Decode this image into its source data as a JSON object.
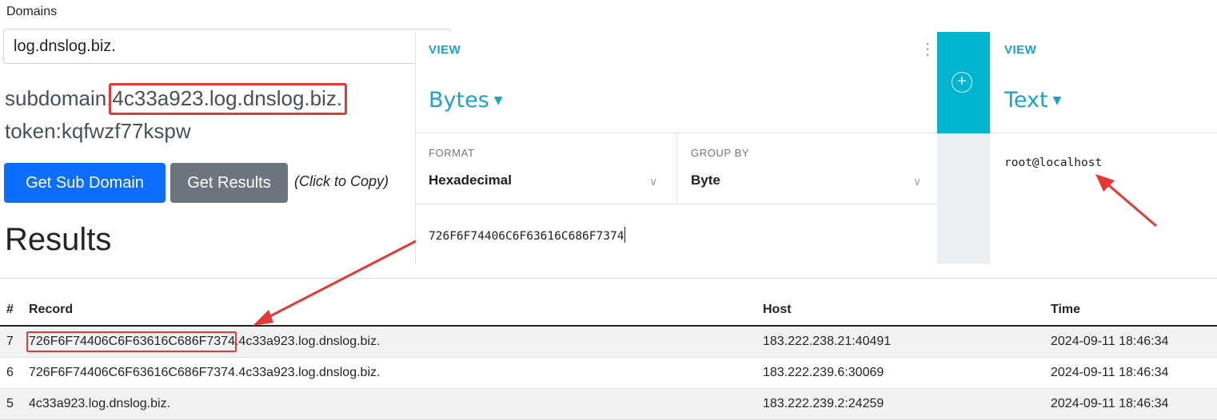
{
  "dnslog": {
    "domains_label": "Domains",
    "domain_value": "log.dnslog.biz.",
    "subdomain_prefix": "subdomain:",
    "subdomain_value": "4c33a923.log.dnslog.biz.",
    "token_text": "token:kqfwzf77kspw",
    "get_sub_domain_label": "Get Sub Domain",
    "get_results_label": "Get Results",
    "copy_hint": "(Click to Copy)",
    "results_title": "Results",
    "table": {
      "headers": [
        "#",
        "Record",
        "Host",
        "Time"
      ],
      "rows": [
        {
          "num": "7",
          "record_hex": "726F6F74406C6F63616C686F7374",
          "record_rest": ".4c33a923.log.dnslog.biz.",
          "host": "183.222.238.21:40491",
          "time": "2024-09-11 18:46:34"
        },
        {
          "num": "6",
          "record": "726F6F74406C6F63616C686F7374.4c33a923.log.dnslog.biz.",
          "host": "183.222.239.6:30069",
          "time": "2024-09-11 18:46:34"
        },
        {
          "num": "5",
          "record": "4c33a923.log.dnslog.biz.",
          "host": "183.222.239.2:24259",
          "time": "2024-09-11 18:46:34"
        }
      ]
    }
  },
  "cyberchef": {
    "left": {
      "view_label": "VIEW",
      "view_value": "Bytes",
      "format_label": "FORMAT",
      "format_value": "Hexadecimal",
      "group_label": "GROUP BY",
      "group_value": "Byte",
      "content": "726F6F74406C6F63616C686F7374"
    },
    "right": {
      "view_label": "VIEW",
      "view_value": "Text",
      "content": "root@localhost"
    }
  },
  "colors": {
    "accent_teal": "#1aa3c9",
    "primary_blue": "#0d6efd",
    "secondary_grey": "#6c757d",
    "annotation_red": "#e53935"
  },
  "icons": [
    "kebab-menu-icon",
    "add-circle-icon",
    "caret-down-icon",
    "chevron-down-icon"
  ]
}
